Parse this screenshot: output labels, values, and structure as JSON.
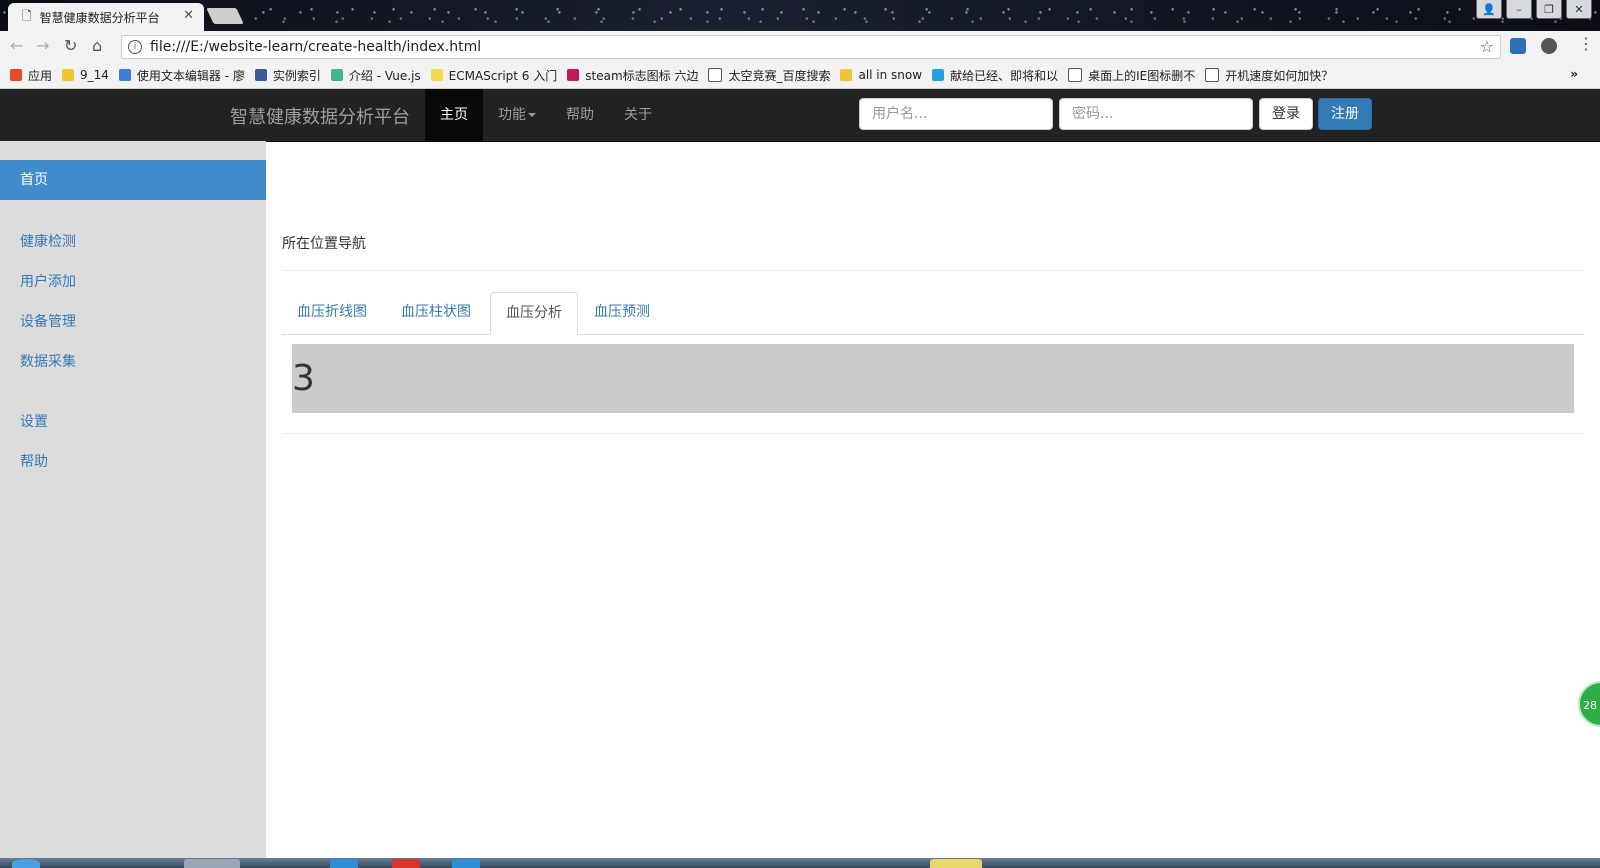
{
  "browser": {
    "tab_title": "智慧健康数据分析平台",
    "tab_close": "✕",
    "url": "file:///E:/website-learn/create-health/index.html",
    "bookmarks": [
      {
        "label": "应用",
        "icon": "apps-grid-icon",
        "color": "#e44d26"
      },
      {
        "label": "9_14",
        "icon": "folder-icon",
        "color": "#f4c430"
      },
      {
        "label": "使用文本编辑器 - 廖",
        "icon": "rocket-icon",
        "color": "#3b7dd8"
      },
      {
        "label": "实例索引",
        "icon": "facebook-icon",
        "color": "#3b5998"
      },
      {
        "label": "介绍 - Vue.js",
        "icon": "vue-icon",
        "color": "#41b883"
      },
      {
        "label": "ECMAScript 6 入门",
        "icon": "es-icon",
        "color": "#f0db4f"
      },
      {
        "label": "steam标志图标 六边",
        "icon": "search-q-icon",
        "color": "#c2185b"
      },
      {
        "label": "太空竞赛_百度搜索",
        "icon": "page-icon",
        "color": "#ffffff"
      },
      {
        "label": "all in snow",
        "icon": "folder-icon",
        "color": "#f4c430"
      },
      {
        "label": "献给已经、即将和以",
        "icon": "bilibili-icon",
        "color": "#23a3dd"
      },
      {
        "label": "桌面上的IE图标删不",
        "icon": "page-icon",
        "color": "#ffffff"
      },
      {
        "label": "开机速度如何加快？",
        "icon": "page-icon",
        "color": "#ffffff"
      }
    ],
    "bookmarks_more": "»"
  },
  "navbar": {
    "brand": "智慧健康数据分析平台",
    "items": [
      {
        "label": "主页",
        "active": true
      },
      {
        "label": "功能",
        "dropdown": true
      },
      {
        "label": "帮助"
      },
      {
        "label": "关于"
      }
    ],
    "username_placeholder": "用户名...",
    "password_placeholder": "密码...",
    "login_label": "登录",
    "register_label": "注册"
  },
  "sidebar": {
    "active": "首页",
    "groups": [
      [
        "健康检测",
        "用户添加",
        "设备管理",
        "数据采集"
      ],
      [
        "设置",
        "帮助"
      ]
    ]
  },
  "main": {
    "breadcrumb": "所在位置导航",
    "tabs": [
      {
        "label": "血压折线图"
      },
      {
        "label": "血压柱状图"
      },
      {
        "label": "血压分析",
        "active": true
      },
      {
        "label": "血压预测"
      }
    ],
    "pane_content": "3"
  },
  "float_badge": "28",
  "colors": {
    "navbar_bg": "#222222",
    "primary": "#337ab7",
    "sidebar_active": "#428bca",
    "sidebar_bg": "#dcdcdc",
    "pane_bg": "#cbcbcb"
  }
}
